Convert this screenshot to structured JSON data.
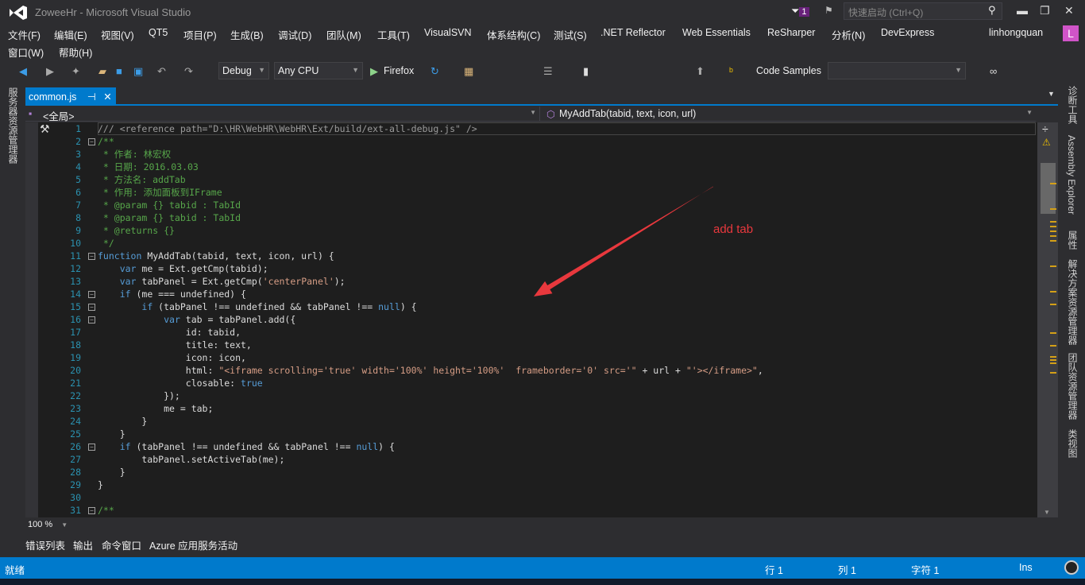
{
  "window": {
    "title": "ZoweeHr - Microsoft Visual Studio",
    "notif_count": "1",
    "quick_launch_placeholder": "快速启动 (Ctrl+Q)",
    "user": "linhongquan",
    "avatar_letter": "L"
  },
  "menu": [
    "文件(F)",
    "编辑(E)",
    "视图(V)",
    "QT5",
    "项目(P)",
    "生成(B)",
    "调试(D)",
    "团队(M)",
    "工具(T)",
    "VisualSVN",
    "体系结构(C)",
    "测试(S)",
    ".NET Reflector",
    "Web Essentials",
    "ReSharper",
    "分析(N)",
    "DevExpress"
  ],
  "menu2": [
    "窗口(W)",
    "帮助(H)"
  ],
  "toolbar": {
    "config": "Debug",
    "platform": "Any CPU",
    "run": "Firefox",
    "code_samples": "Code Samples",
    "search_value": ""
  },
  "left_panels": [
    "服务器资源管理器"
  ],
  "right_panels": [
    "诊断工具",
    "Assembly Explorer",
    "属性",
    "解决方案资源管理器",
    "团队资源管理器",
    "类视图"
  ],
  "tab": {
    "name": "common.js"
  },
  "nav": {
    "scope": "<全局>",
    "member": "MyAddTab(tabid, text, icon, url)"
  },
  "code": [
    [
      [
        "g",
        "/// <reference path=\"D:\\HR\\WebHR\\WebHR\\Ext/build/ext-all-debug.js\" />"
      ]
    ],
    [
      [
        "c",
        "/**"
      ]
    ],
    [
      [
        "c",
        " * 作者: 林宏权"
      ]
    ],
    [
      [
        "c",
        " * 日期: 2016.03.03"
      ]
    ],
    [
      [
        "c",
        " * 方法名: addTab"
      ]
    ],
    [
      [
        "c",
        " * 作用: 添加面板到IFrame"
      ]
    ],
    [
      [
        "c",
        " * @param {} tabid : TabId"
      ]
    ],
    [
      [
        "c",
        " * @param {} tabid : TabId"
      ]
    ],
    [
      [
        "c",
        " * @returns {}"
      ]
    ],
    [
      [
        "c",
        " */"
      ]
    ],
    [
      [
        "k",
        "function"
      ],
      [
        "t",
        " MyAddTab(tabid, text, icon, url) {"
      ]
    ],
    [
      [
        "t",
        "    "
      ],
      [
        "k",
        "var"
      ],
      [
        "t",
        " me = Ext.getCmp(tabid);"
      ]
    ],
    [
      [
        "t",
        "    "
      ],
      [
        "k",
        "var"
      ],
      [
        "t",
        " tabPanel = Ext.getCmp("
      ],
      [
        "s",
        "'centerPanel'"
      ],
      [
        "t",
        ");"
      ]
    ],
    [
      [
        "t",
        "    "
      ],
      [
        "k",
        "if"
      ],
      [
        "t",
        " (me === undefined) {"
      ]
    ],
    [
      [
        "t",
        "        "
      ],
      [
        "k",
        "if"
      ],
      [
        "t",
        " (tabPanel !== undefined && tabPanel !== "
      ],
      [
        "k",
        "null"
      ],
      [
        "t",
        ") {"
      ]
    ],
    [
      [
        "t",
        "            "
      ],
      [
        "k",
        "var"
      ],
      [
        "t",
        " tab = tabPanel.add({"
      ]
    ],
    [
      [
        "t",
        "                id: tabid,"
      ]
    ],
    [
      [
        "t",
        "                title: text,"
      ]
    ],
    [
      [
        "t",
        "                icon: icon,"
      ]
    ],
    [
      [
        "t",
        "                html: "
      ],
      [
        "s",
        "\"<iframe scrolling='true' width='100%' height='100%'  frameborder='0' src='\""
      ],
      [
        "t",
        " + url + "
      ],
      [
        "s",
        "\"'></iframe>\""
      ],
      [
        "t",
        ","
      ]
    ],
    [
      [
        "t",
        "                closable: "
      ],
      [
        "k",
        "true"
      ]
    ],
    [
      [
        "t",
        "            });"
      ]
    ],
    [
      [
        "t",
        "            me = tab;"
      ]
    ],
    [
      [
        "t",
        "        }"
      ]
    ],
    [
      [
        "t",
        "    }"
      ]
    ],
    [
      [
        "t",
        "    "
      ],
      [
        "k",
        "if"
      ],
      [
        "t",
        " (tabPanel !== undefined && tabPanel !== "
      ],
      [
        "k",
        "null"
      ],
      [
        "t",
        ") {"
      ]
    ],
    [
      [
        "t",
        "        tabPanel.setActiveTab(me);"
      ]
    ],
    [
      [
        "t",
        "    }"
      ]
    ],
    [
      [
        "t",
        "}"
      ]
    ],
    [
      [
        "t",
        ""
      ]
    ],
    [
      [
        "c",
        "/**"
      ]
    ]
  ],
  "line_numbers": [
    "1",
    "2",
    "3",
    "4",
    "5",
    "6",
    "7",
    "8",
    "9",
    "10",
    "11",
    "12",
    "13",
    "14",
    "15",
    "16",
    "17",
    "18",
    "19",
    "20",
    "21",
    "22",
    "23",
    "24",
    "25",
    "26",
    "27",
    "28",
    "29",
    "30",
    "31"
  ],
  "annotation": {
    "text": "add tab",
    "color": "#e8383d"
  },
  "zoom": "100 %",
  "bottom_tabs": [
    "错误列表",
    "输出",
    "命令窗口",
    "Azure 应用服务活动"
  ],
  "status": {
    "text": "就绪",
    "row": "行 1",
    "col": "列 1",
    "char": "字符 1",
    "mode": "Ins"
  },
  "colors": {
    "accent": "#007acc",
    "keyword": "#569cd6",
    "string": "#d69d85",
    "comment": "#57a64a",
    "line_number": "#2b91af"
  }
}
